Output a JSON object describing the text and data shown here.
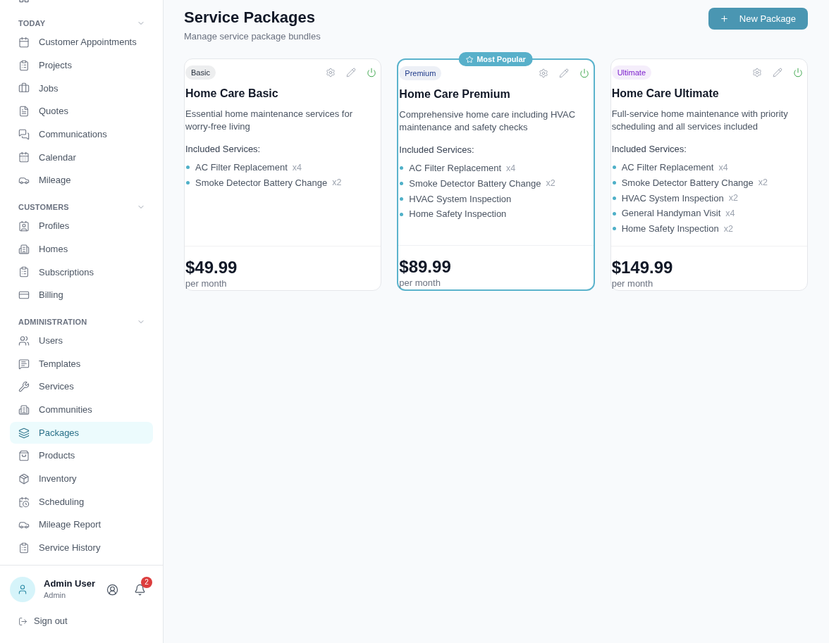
{
  "sidebar": {
    "sections": [
      {
        "title": "TODAY",
        "expanded": true,
        "items": [
          {
            "label": "Customer Appointments",
            "selected": false
          },
          {
            "label": "Projects",
            "selected": false
          },
          {
            "label": "Jobs",
            "selected": false
          },
          {
            "label": "Quotes",
            "selected": false
          },
          {
            "label": "Communications",
            "selected": false
          },
          {
            "label": "Calendar",
            "selected": false
          },
          {
            "label": "Mileage",
            "selected": false
          }
        ]
      },
      {
        "title": "CUSTOMERS",
        "expanded": true,
        "items": [
          {
            "label": "Profiles",
            "selected": false
          },
          {
            "label": "Homes",
            "selected": false
          },
          {
            "label": "Subscriptions",
            "selected": false
          },
          {
            "label": "Billing",
            "selected": false
          }
        ]
      },
      {
        "title": "ADMINISTRATION",
        "expanded": true,
        "items": [
          {
            "label": "Users",
            "selected": false
          },
          {
            "label": "Templates",
            "selected": false
          },
          {
            "label": "Services",
            "selected": false
          },
          {
            "label": "Communities",
            "selected": false
          },
          {
            "label": "Packages",
            "selected": true
          },
          {
            "label": "Products",
            "selected": false
          },
          {
            "label": "Inventory",
            "selected": false
          },
          {
            "label": "Scheduling",
            "selected": false
          },
          {
            "label": "Mileage Report",
            "selected": false
          },
          {
            "label": "Service History",
            "selected": false
          }
        ]
      }
    ],
    "user": {
      "name": "Admin User",
      "role": "Admin",
      "notification_count": "2"
    },
    "sign_out": "Sign out"
  },
  "header": {
    "title": "Service Packages",
    "subtitle": "Manage service package bundles",
    "new_button": "New Package"
  },
  "packages": [
    {
      "tag": {
        "label": "Basic",
        "color": "#1f2937"
      },
      "highlighted": false,
      "active": true,
      "name": "Home Care Basic",
      "description": "Essential home maintenance services for worry-free living",
      "services_heading": "Included Services:",
      "services": [
        {
          "name": "AC Filter Replacement",
          "quantity": "x4"
        },
        {
          "name": "Smoke Detector Battery Change",
          "quantity": "x2"
        }
      ],
      "price": "$49.99",
      "period": "per month"
    },
    {
      "tag": {
        "label": "Premium",
        "color": "#1e3a8a"
      },
      "highlighted": true,
      "ribbon": "Most Popular",
      "active": true,
      "name": "Home Care Premium",
      "description": "Comprehensive home care including HVAC maintenance and safety checks",
      "services_heading": "Included Services:",
      "services": [
        {
          "name": "AC Filter Replacement",
          "quantity": "x4"
        },
        {
          "name": "Smoke Detector Battery Change",
          "quantity": "x2"
        },
        {
          "name": "HVAC System Inspection"
        },
        {
          "name": "Home Safety Inspection"
        }
      ],
      "price": "$89.99",
      "period": "per month"
    },
    {
      "tag": {
        "label": "Ultimate",
        "color": "#7e22ce"
      },
      "highlighted": false,
      "active": true,
      "name": "Home Care Ultimate",
      "description": "Full-service home maintenance with priority scheduling and all services included",
      "services_heading": "Included Services:",
      "services": [
        {
          "name": "AC Filter Replacement",
          "quantity": "x4"
        },
        {
          "name": "Smoke Detector Battery Change",
          "quantity": "x2"
        },
        {
          "name": "HVAC System Inspection",
          "quantity": "x2"
        },
        {
          "name": "General Handyman Visit",
          "quantity": "x4"
        },
        {
          "name": "Home Safety Inspection",
          "quantity": "x2"
        }
      ],
      "price": "$149.99",
      "period": "per month"
    }
  ]
}
